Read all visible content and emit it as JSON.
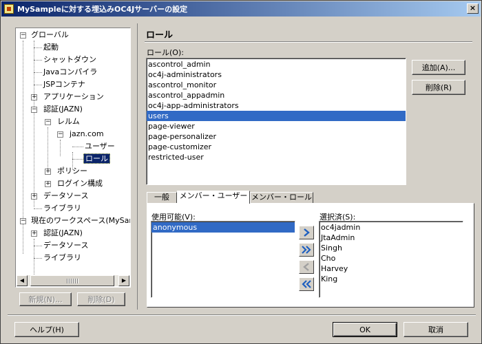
{
  "window": {
    "title": "MySampleに対する埋込みOC4Jサーバーの設定"
  },
  "tree": {
    "items": [
      {
        "label": "グローバル",
        "expander": "−"
      },
      {
        "label": "起動"
      },
      {
        "label": "シャットダウン"
      },
      {
        "label": "Javaコンパイラ"
      },
      {
        "label": "JSPコンテナ"
      },
      {
        "label": "アプリケーション",
        "expander": "+"
      },
      {
        "label": "認証(JAZN)",
        "expander": "−"
      },
      {
        "label": "レルム",
        "expander": "−"
      },
      {
        "label": "jazn.com",
        "expander": "−"
      },
      {
        "label": "ユーザー"
      },
      {
        "label": "ロール"
      },
      {
        "label": "ポリシー",
        "expander": "+"
      },
      {
        "label": "ログイン構成",
        "expander": "+"
      },
      {
        "label": "データソース",
        "expander": "+"
      },
      {
        "label": "ライブラリ"
      },
      {
        "label": "現在のワークスペース(MySamp",
        "expander": "−"
      },
      {
        "label": "認証(JAZN)",
        "expander": "+"
      },
      {
        "label": "データソース"
      },
      {
        "label": "ライブラリ"
      }
    ],
    "new_button": "新規(N)...",
    "delete_button": "削除(D)"
  },
  "roles_section": {
    "title": "ロール",
    "list_label": "ロール(O):",
    "roles": [
      "ascontrol_admin",
      "oc4j-administrators",
      "ascontrol_monitor",
      "ascontrol_appadmin",
      "oc4j-app-administrators",
      "users",
      "page-viewer",
      "page-personalizer",
      "page-customizer",
      "restricted-user"
    ],
    "selected_role": "users",
    "add_button": "追加(A)...",
    "remove_button": "削除(R)"
  },
  "tabs": [
    {
      "label": "一般"
    },
    {
      "label": "メンバー・ユーザー",
      "active": true
    },
    {
      "label": "メンバー・ロール"
    }
  ],
  "members": {
    "available_label": "使用可能(V):",
    "available": [
      "anonymous"
    ],
    "selected_label": "選択済(S):",
    "selected": [
      "oc4jadmin",
      "JtaAdmin",
      "Singh",
      "Cho",
      "Harvey",
      "King"
    ]
  },
  "footer": {
    "help_button": "ヘルプ(H)",
    "ok_button": "OK",
    "cancel_button": "取消"
  },
  "colors": {
    "selection": "#316ac5",
    "titlebar_start": "#0a246a",
    "titlebar_end": "#a6caf0",
    "face": "#d4d0c8"
  }
}
